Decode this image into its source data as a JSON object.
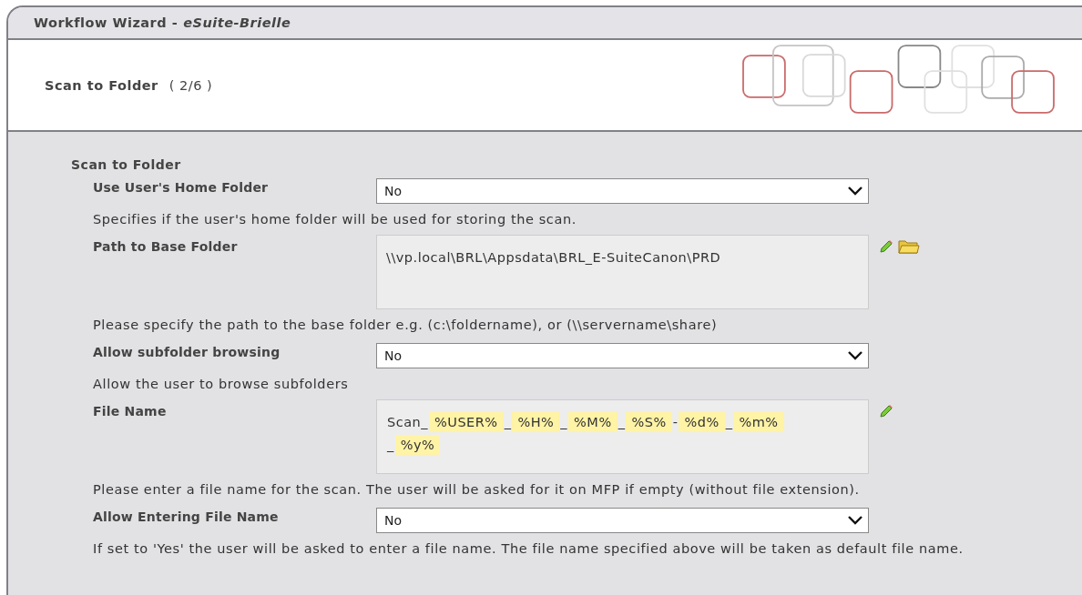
{
  "window": {
    "title": "Workflow Wizard -",
    "subtitle": "eSuite-Brielle"
  },
  "step": {
    "title": "Scan to Folder",
    "counter": "( 2/6 )"
  },
  "section": {
    "title": "Scan to Folder",
    "fields": [
      {
        "kind": "select",
        "label": "Use User's Home Folder",
        "value": "No",
        "help": "Specifies if the user's home folder will be used for storing the scan.",
        "edit_button": false,
        "browse_button": false
      },
      {
        "kind": "textarea",
        "label": "Path to Base Folder",
        "value": "\\\\vp.local\\BRL\\Appsdata\\BRL_E-SuiteCanon\\PRD",
        "help": "Please specify the path to the base folder e.g. (c:\\foldername), or (\\\\servername\\share)",
        "edit_button": true,
        "browse_button": true
      },
      {
        "kind": "select",
        "label": "Allow subfolder browsing",
        "value": "No",
        "help": "Allow the user to browse subfolders",
        "edit_button": false,
        "browse_button": false
      },
      {
        "kind": "tokens",
        "label": "File Name",
        "tokens": [
          {
            "text": "Scan_",
            "highlighted": false
          },
          {
            "text": "%USER%",
            "highlighted": true
          },
          {
            "text": "_",
            "highlighted": false
          },
          {
            "text": "%H%",
            "highlighted": true
          },
          {
            "text": "_",
            "highlighted": false
          },
          {
            "text": "%M%",
            "highlighted": true
          },
          {
            "text": "_",
            "highlighted": false
          },
          {
            "text": "%S%",
            "highlighted": true
          },
          {
            "text": "-",
            "highlighted": false
          },
          {
            "text": "%d%",
            "highlighted": true
          },
          {
            "text": "_",
            "highlighted": false
          },
          {
            "text": "%m%",
            "highlighted": true
          },
          {
            "text": "_",
            "highlighted": false
          },
          {
            "text": "%y%",
            "highlighted": true
          }
        ],
        "help": "Please enter a file name for the scan. The user will be asked for it on MFP if empty (without file extension).",
        "edit_button": true,
        "browse_button": false
      },
      {
        "kind": "select",
        "label": "Allow Entering File Name",
        "value": "No",
        "help": "If set to 'Yes' the user will be asked to enter a file name. The file name specified above will be taken as default file name.",
        "edit_button": false,
        "browse_button": false
      }
    ]
  }
}
